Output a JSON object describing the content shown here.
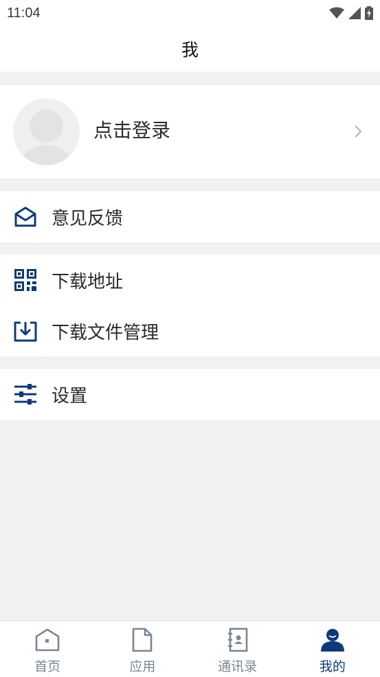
{
  "status_bar": {
    "time": "11:04"
  },
  "header": {
    "title": "我"
  },
  "profile": {
    "login_label": "点击登录"
  },
  "menu": {
    "feedback": "意见反馈",
    "download_address": "下载地址",
    "download_file_management": "下载文件管理",
    "settings": "设置"
  },
  "bottom_nav": [
    {
      "label": "首页",
      "icon": "home-icon",
      "active": false
    },
    {
      "label": "应用",
      "icon": "document-icon",
      "active": false
    },
    {
      "label": "通讯录",
      "icon": "contacts-icon",
      "active": false
    },
    {
      "label": "我的",
      "icon": "user-icon",
      "active": true
    }
  ],
  "colors": {
    "accent": "#0e3a7a",
    "inactive": "#7a8696",
    "background": "#f1f1f1"
  }
}
